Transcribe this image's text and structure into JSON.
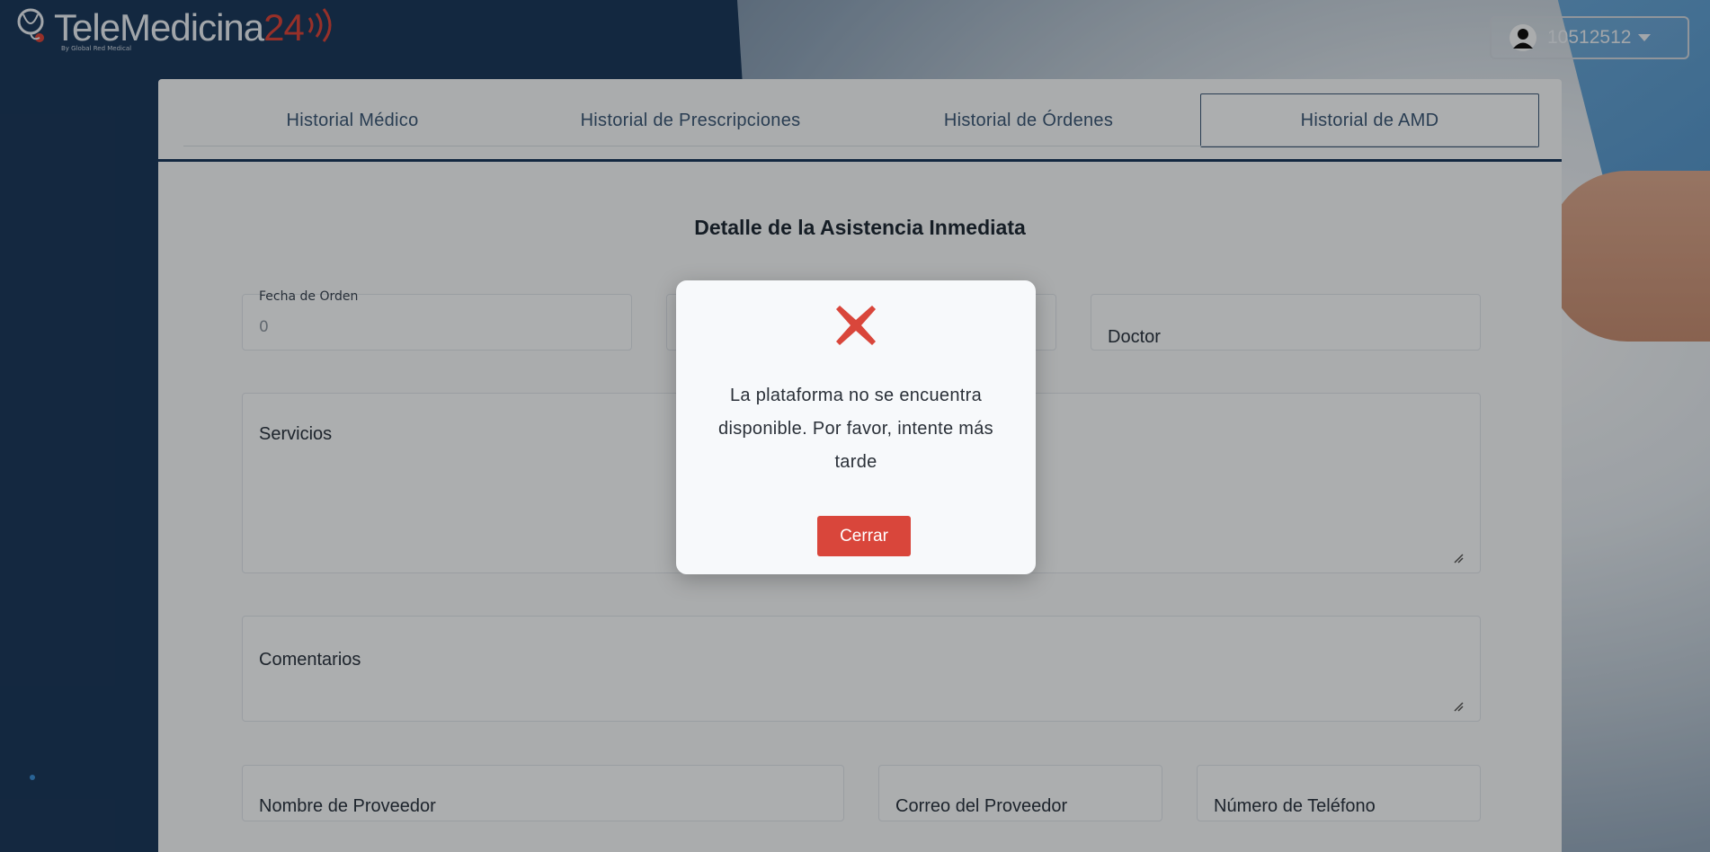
{
  "app": {
    "brand_main": "TeleMedicina",
    "brand_number": "24",
    "brand_sub": "By Global Red Medical",
    "user_label": "10512512"
  },
  "tabs": [
    {
      "label": "Historial Médico",
      "active": false
    },
    {
      "label": "Historial de Prescripciones",
      "active": false
    },
    {
      "label": "Historial de Órdenes",
      "active": false
    },
    {
      "label": "Historial de AMD",
      "active": true
    }
  ],
  "detail": {
    "title": "Detalle de la Asistencia Inmediata",
    "fecha_label": "Fecha de Orden",
    "fecha_value": "0",
    "doctor_label": "Doctor",
    "servicios_label": "Servicios",
    "comentarios_label": "Comentarios",
    "proveedor_label": "Nombre de Proveedor",
    "correo_label": "Correo del Proveedor",
    "telefono_label": "Número de Teléfono"
  },
  "modal": {
    "message": "La plataforma no se encuentra disponible. Por favor, intente más tarde",
    "close_label": "Cerrar"
  },
  "colors": {
    "navy": "#1c3a5c",
    "accent_red": "#d9463b",
    "tab_text": "#3b5876"
  },
  "icons": {
    "error": "x-mark-icon",
    "user": "user-avatar-icon",
    "caret": "caret-down-icon"
  }
}
